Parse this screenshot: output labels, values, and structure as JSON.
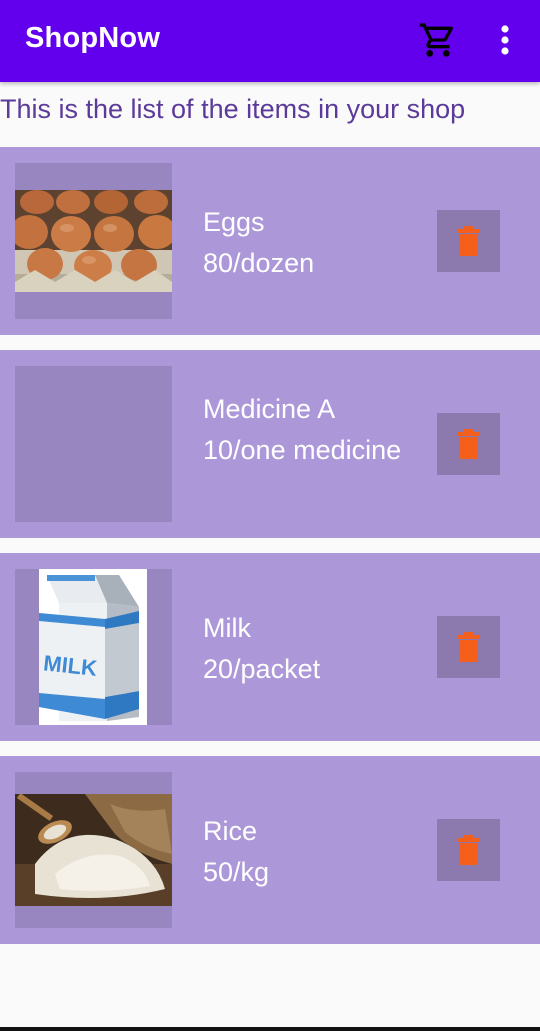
{
  "app_bar": {
    "title": "ShopNow",
    "cart_icon": "shopping-cart-icon",
    "menu_icon": "more-vertical-icon",
    "background_color": "#6200ee"
  },
  "subtitle": "This is the list of the items in your shop",
  "items": [
    {
      "name": "Eggs",
      "price": "80/dozen",
      "image": "eggs-photo",
      "delete_icon": "trash-icon"
    },
    {
      "name": "Medicine A",
      "price": "10/one medicine",
      "image": "",
      "delete_icon": "trash-icon"
    },
    {
      "name": "Milk",
      "price": "20/packet",
      "image": "milk-carton-image",
      "delete_icon": "trash-icon"
    },
    {
      "name": "Rice",
      "price": "50/kg",
      "image": "rice-sack-photo",
      "delete_icon": "trash-icon"
    }
  ],
  "colors": {
    "card_background": "#ac98d8",
    "delete_button_background": "#8c7aae",
    "delete_icon": "#f4601c",
    "subtitle_text": "#5b3a9a"
  }
}
